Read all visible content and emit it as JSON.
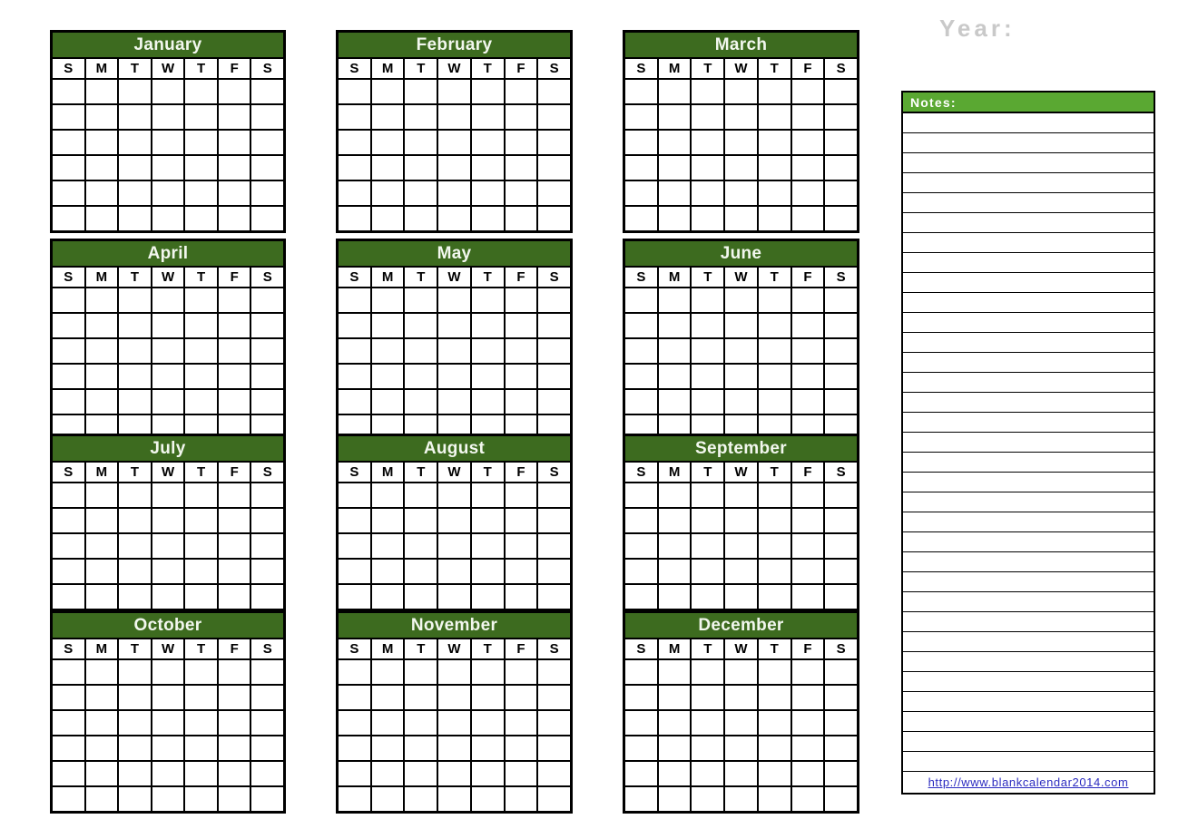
{
  "header": {
    "year_label": "Year:"
  },
  "weekdays": [
    "S",
    "M",
    "T",
    "W",
    "T",
    "F",
    "S"
  ],
  "months": [
    {
      "name": "January",
      "weeks": 6,
      "col": 0,
      "row": 0
    },
    {
      "name": "February",
      "weeks": 6,
      "col": 1,
      "row": 0
    },
    {
      "name": "March",
      "weeks": 6,
      "col": 2,
      "row": 0
    },
    {
      "name": "April",
      "weeks": 6,
      "col": 0,
      "row": 1
    },
    {
      "name": "May",
      "weeks": 6,
      "col": 1,
      "row": 1
    },
    {
      "name": "June",
      "weeks": 6,
      "col": 2,
      "row": 1
    },
    {
      "name": "July",
      "weeks": 5,
      "col": 0,
      "row": 2
    },
    {
      "name": "August",
      "weeks": 5,
      "col": 1,
      "row": 2
    },
    {
      "name": "September",
      "weeks": 5,
      "col": 2,
      "row": 2
    },
    {
      "name": "October",
      "weeks": 6,
      "col": 0,
      "row": 3
    },
    {
      "name": "November",
      "weeks": 6,
      "col": 1,
      "row": 3
    },
    {
      "name": "December",
      "weeks": 6,
      "col": 2,
      "row": 3
    }
  ],
  "notes": {
    "title": "Notes:",
    "line_count": 33,
    "link_text": "http://www.blankcalendar2014.com"
  },
  "colors": {
    "month_header_green": "#3d6b1f",
    "notes_header_green": "#5aa832",
    "grid_black": "#000000",
    "year_gray": "#c9c9c9",
    "link_blue": "#2b2bc0"
  }
}
